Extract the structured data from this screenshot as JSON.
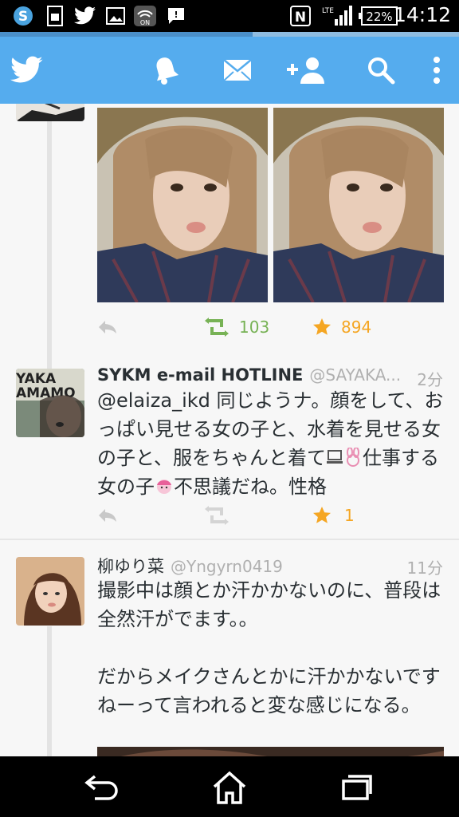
{
  "status_bar": {
    "time": "14:12",
    "battery": "22%",
    "network": "LTE",
    "icons": [
      "skype-icon",
      "sim-icon",
      "twitter-icon",
      "image-icon",
      "wifi-off-icon",
      "message-icon",
      "nfc-icon",
      "signal-icon",
      "battery-icon"
    ]
  },
  "progress": {
    "fraction": 0.55
  },
  "action_bar": {
    "icons": [
      "twitter-bird-icon",
      "bell-icon",
      "envelope-icon",
      "add-user-icon",
      "search-icon",
      "overflow-menu-icon"
    ]
  },
  "tweets": [
    {
      "id": "photo-tweet",
      "retweets": "103",
      "favorites": "894",
      "photo_count": 2
    },
    {
      "id": "sykm-tweet",
      "name": "SYKM e-mail HOTLINE",
      "handle": "@SAYAKA...",
      "time": "2分",
      "mention": "@elaiza_ikd",
      "text": " 同じようナ。顔をして、おっぱい見せる女の子と、水着を見せる女の子と、服をちゃんと着て",
      "text_tail": "仕事する女の子",
      "text_end": "不思議だね。性格",
      "avatar_text": "YAKA\nAMAMO",
      "favorites": "1"
    },
    {
      "id": "yuri-tweet",
      "name": "柳ゆり菜",
      "handle": "@Yngyrn0419",
      "time": "11分",
      "text": "撮影中は顔とか汗かかないのに、普段は全然汗がでます。。\n\nだからメイクさんとかに汗かかないですねーって言われると変な感じになる。"
    }
  ],
  "nav_bar": {
    "icons": [
      "back-icon",
      "home-icon",
      "recent-apps-icon"
    ]
  },
  "colors": {
    "brand": "#55acee",
    "retweet": "#77b255",
    "star": "#f5a623"
  }
}
